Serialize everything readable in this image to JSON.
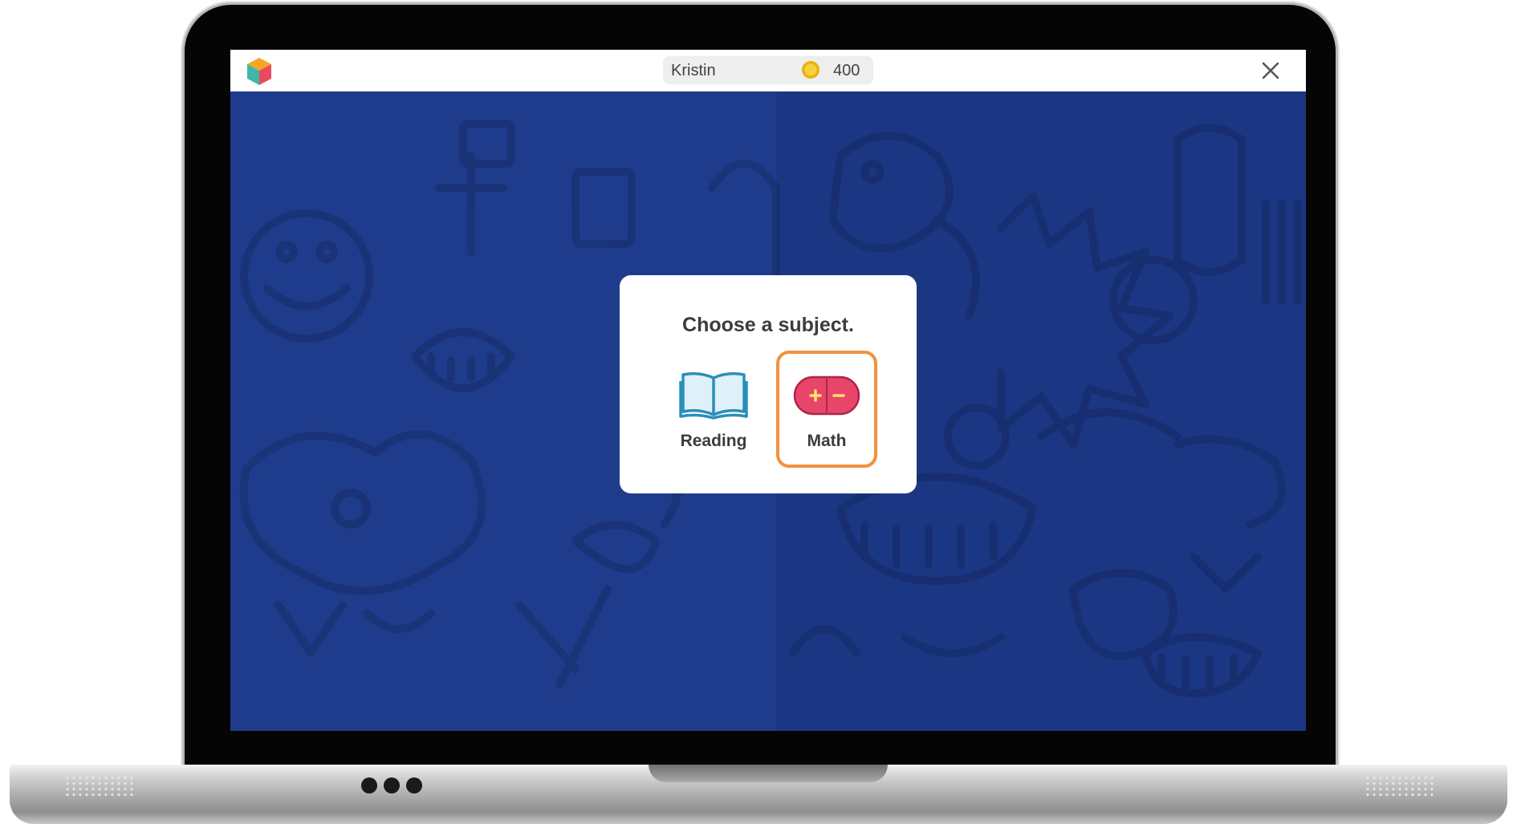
{
  "app": {
    "user_name": "Kristin",
    "coins": "400",
    "logo_icon": "colored-cube-icon",
    "coin_icon": "gold-coin-icon",
    "close_icon": "close-icon"
  },
  "dialog": {
    "title": "Choose a subject.",
    "subjects": [
      {
        "label": "Reading",
        "icon": "open-book-icon",
        "selected": false
      },
      {
        "label": "Math",
        "icon": "plus-minus-icon",
        "selected": true
      }
    ]
  },
  "colors": {
    "background": "#1f3c8c",
    "selection_outline": "#f2913d",
    "math_icon": "#e8456a",
    "reading_icon": "#3aa0c8"
  }
}
